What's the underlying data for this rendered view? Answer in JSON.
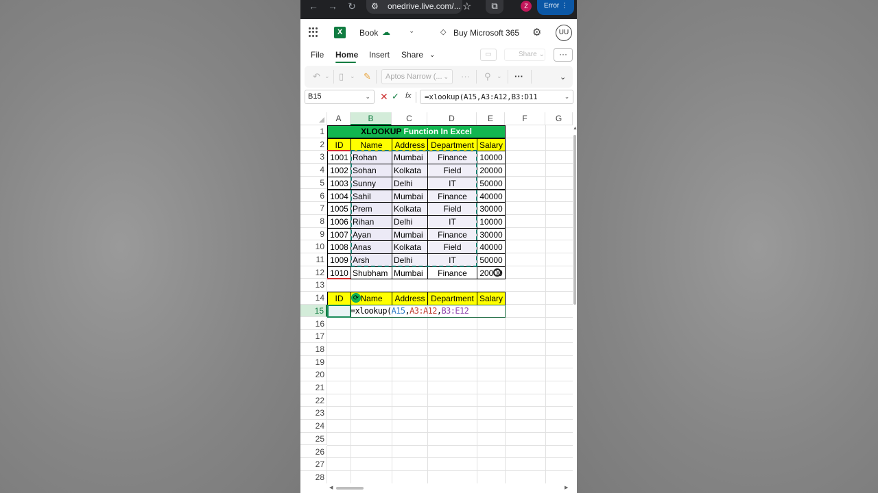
{
  "browser": {
    "url": "onedrive.live.com/...",
    "profile_initial": "Z",
    "error_label": "Error"
  },
  "app": {
    "title": "Book",
    "buy_label": "Buy Microsoft 365",
    "user_initials": "UU",
    "accent": "#107c41"
  },
  "menu": {
    "items": [
      "File",
      "Home",
      "Insert",
      "Share"
    ],
    "active": "Home",
    "share_button": "Share"
  },
  "ribbon": {
    "font_name": "Aptos Narrow (..."
  },
  "formula_bar": {
    "name_box": "B15",
    "fx": "fx",
    "formula": "=xlookup(A15,A3:A12,B3:D11"
  },
  "columns": [
    "A",
    "B",
    "C",
    "D",
    "E",
    "F",
    "G"
  ],
  "rows": [
    "1",
    "2",
    "3",
    "4",
    "5",
    "6",
    "7",
    "8",
    "9",
    "10",
    "11",
    "12",
    "13",
    "14",
    "15",
    "16",
    "17",
    "18",
    "19",
    "20",
    "21",
    "22",
    "23",
    "24",
    "25",
    "26",
    "27",
    "28"
  ],
  "sheet": {
    "banner_part1": "XLOOKUP",
    "banner_part2": " Function In Excel",
    "headers": [
      "ID",
      "Name",
      "Address",
      "Department",
      "Salary"
    ],
    "data": [
      [
        "1001",
        "Rohan",
        "Mumbai",
        "Finance",
        "10000"
      ],
      [
        "1002",
        "Sohan",
        "Kolkata",
        "Field",
        "20000"
      ],
      [
        "1003",
        "Sunny",
        "Delhi",
        "IT",
        "50000"
      ],
      [
        "1004",
        "Sahil",
        "Mumbai",
        "Finance",
        "40000"
      ],
      [
        "1005",
        "Prem",
        "Kolkata",
        "Field",
        "30000"
      ],
      [
        "1006",
        "Rihan",
        "Delhi",
        "IT",
        "10000"
      ],
      [
        "1007",
        "Ayan",
        "Mumbai",
        "Finance",
        "30000"
      ],
      [
        "1008",
        "Anas",
        "Kolkata",
        "Field",
        "40000"
      ],
      [
        "1009",
        "Arsh",
        "Delhi",
        "IT",
        "50000"
      ],
      [
        "1010",
        "Shubham",
        "Mumbai",
        "Finance",
        "20000"
      ]
    ],
    "lookup_headers": [
      "ID",
      "Name",
      "Address",
      "Department",
      "Salary"
    ],
    "edit_formula": {
      "prefix": "=xlookup(",
      "arg1": "A15",
      "sep1": ",",
      "arg2": "A3:A12",
      "sep2": ",",
      "arg3": "B3:E12"
    }
  }
}
